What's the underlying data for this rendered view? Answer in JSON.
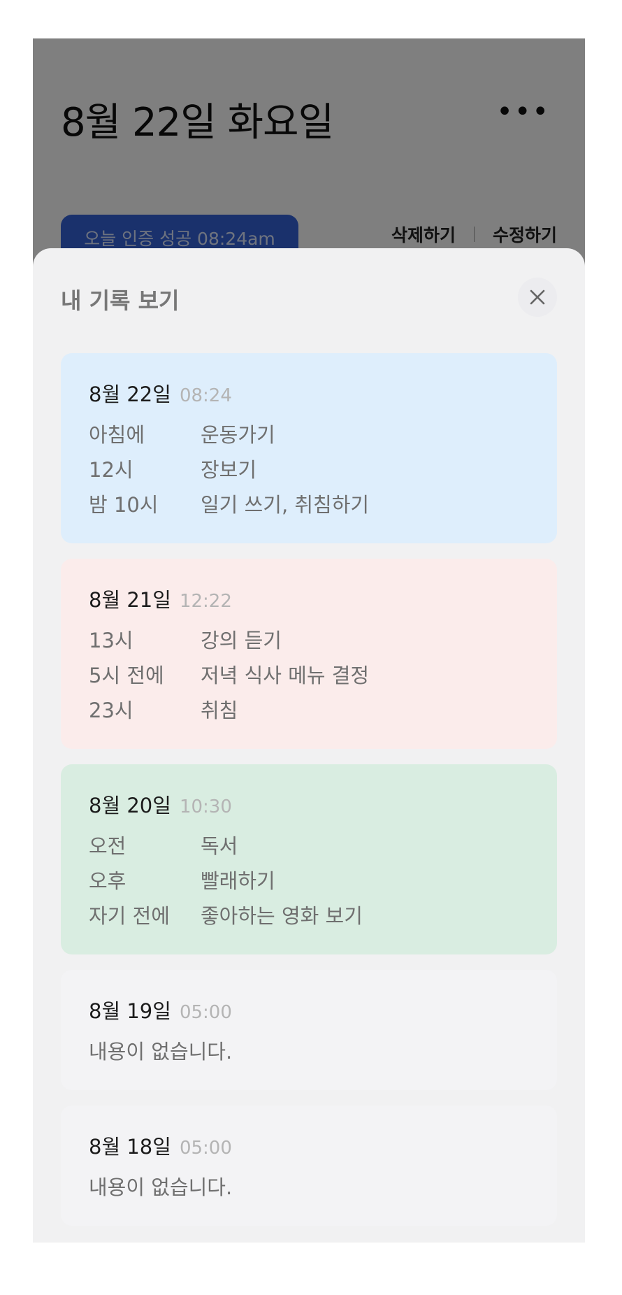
{
  "page": {
    "title": "8월 22일 화요일",
    "more_icon": "more-horizontal-icon",
    "badge": "오늘 인증 성공 08:24am",
    "delete_label": "삭제하기",
    "edit_label": "수정하기"
  },
  "sheet": {
    "title": "내 기록 보기",
    "close_icon": "close-icon"
  },
  "records": [
    {
      "date": "8월 22일",
      "time": "08:24",
      "color": "#deeefc",
      "empty": "",
      "rows": [
        {
          "when": "아침에",
          "what": "운동가기"
        },
        {
          "when": "12시",
          "what": "장보기"
        },
        {
          "when": "밤 10시",
          "what": "일기 쓰기, 취침하기"
        }
      ]
    },
    {
      "date": "8월 21일",
      "time": "12:22",
      "color": "#fbeceb",
      "empty": "",
      "rows": [
        {
          "when": "13시",
          "what": "강의 듣기"
        },
        {
          "when": "5시 전에",
          "what": "저녁 식사 메뉴 결정"
        },
        {
          "when": "23시",
          "what": "취침"
        }
      ]
    },
    {
      "date": "8월 20일",
      "time": "10:30",
      "color": "#d9ede1",
      "empty": "",
      "rows": [
        {
          "when": "오전",
          "what": "독서"
        },
        {
          "when": "오후",
          "what": "빨래하기"
        },
        {
          "when": "자기 전에",
          "what": "좋아하는 영화 보기"
        }
      ]
    },
    {
      "date": "8월 19일",
      "time": "05:00",
      "color": "#f3f3f5",
      "rows": [],
      "empty": "내용이 없습니다."
    },
    {
      "date": "8월 18일",
      "time": "05:00",
      "color": "#f3f3f5",
      "rows": [],
      "empty": "내용이 없습니다."
    }
  ]
}
